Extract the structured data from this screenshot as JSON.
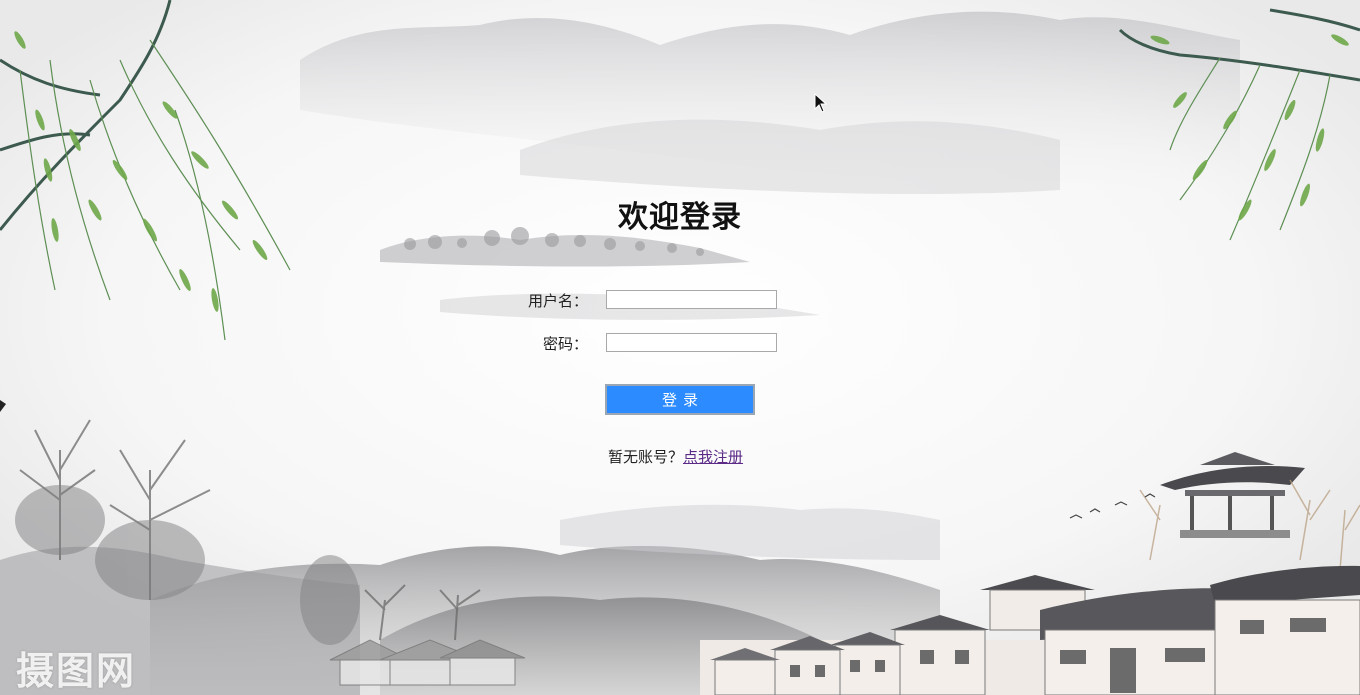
{
  "login": {
    "title": "欢迎登录",
    "username_label": "用户名：",
    "username_value": "",
    "password_label": "密码：",
    "password_value": "",
    "submit_label": "登录",
    "no_account_text": "暂无账号？",
    "register_link": "点我注册"
  },
  "watermark": "摄图网",
  "icons": {
    "cursor": "mouse-pointer-icon"
  },
  "colors": {
    "button": "#2b8bff",
    "link": "#5a2a86",
    "background": "#f7f7f7"
  }
}
